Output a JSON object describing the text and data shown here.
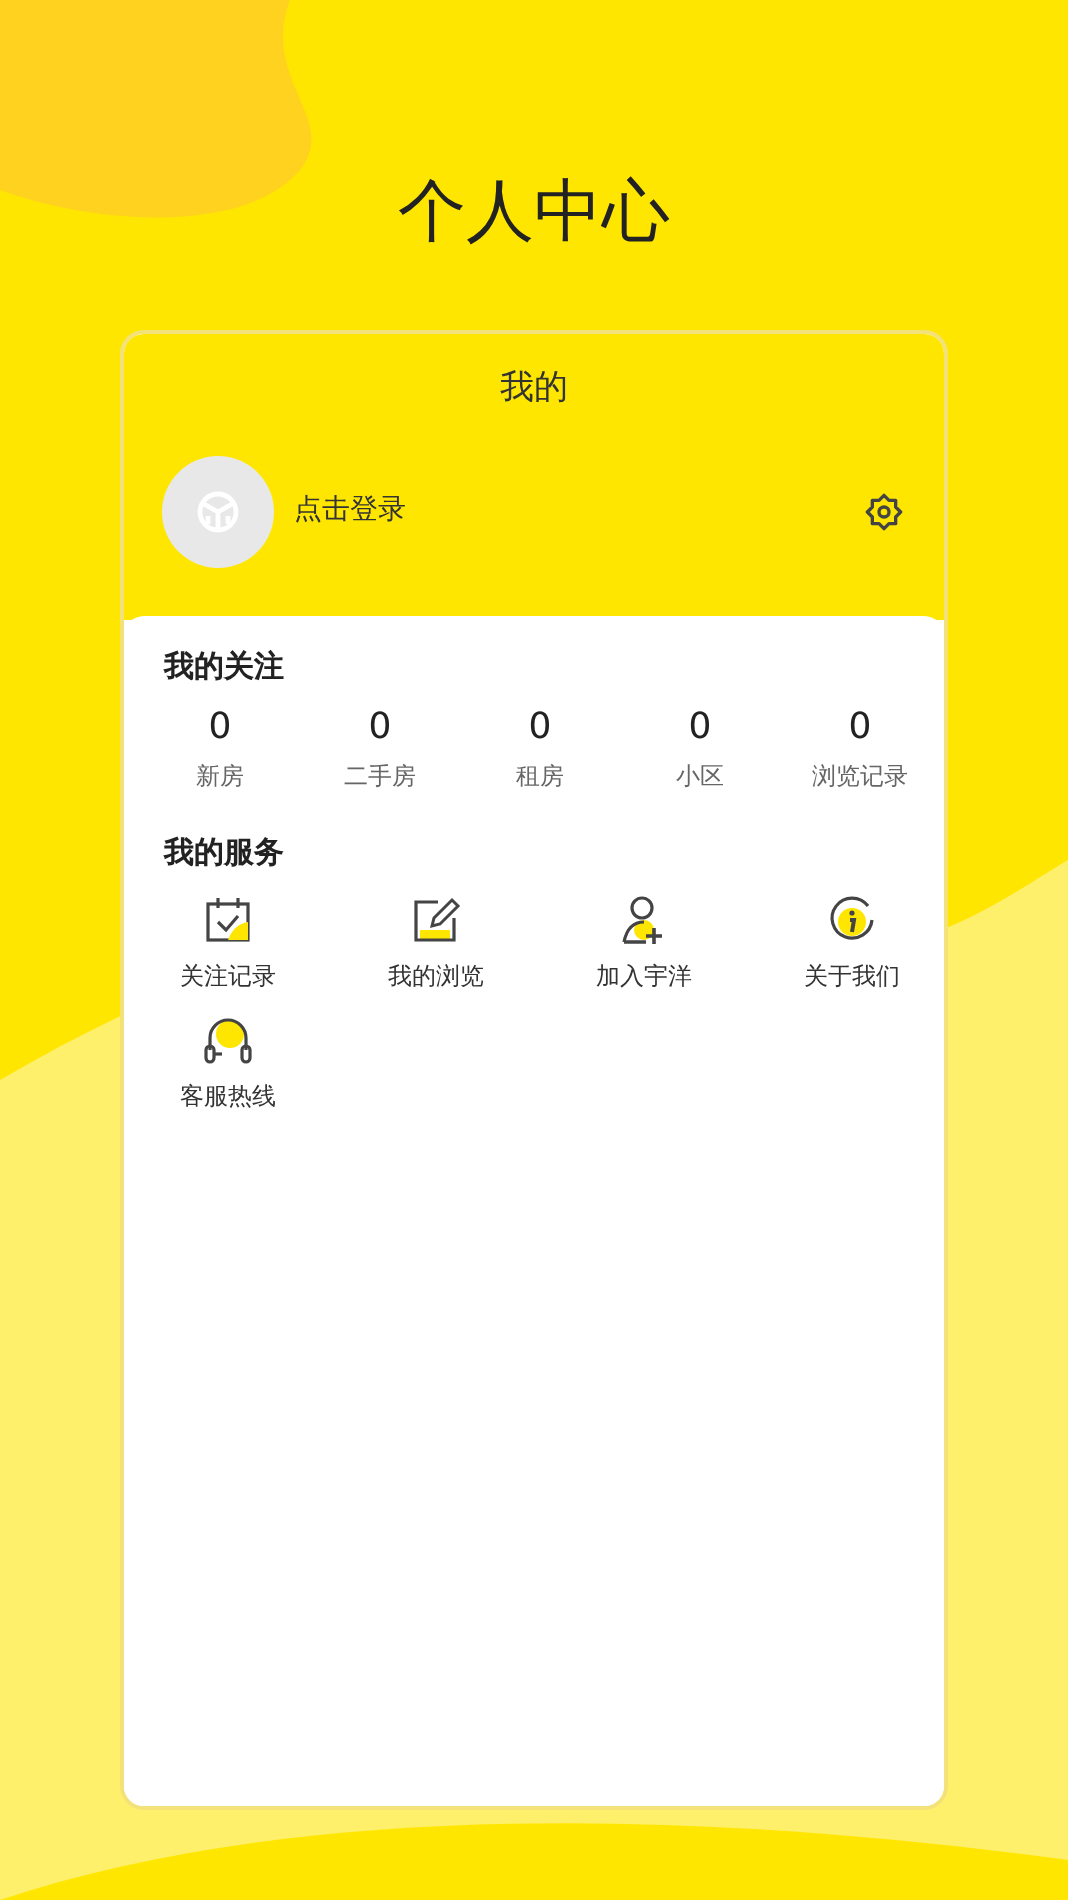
{
  "page_title": "个人中心",
  "card": {
    "title": "我的",
    "login": "点击登录"
  },
  "follows": {
    "heading": "我的关注",
    "items": [
      {
        "count": "0",
        "label": "新房"
      },
      {
        "count": "0",
        "label": "二手房"
      },
      {
        "count": "0",
        "label": "租房"
      },
      {
        "count": "0",
        "label": "小区"
      },
      {
        "count": "0",
        "label": "浏览记录"
      }
    ]
  },
  "services": {
    "heading": "我的服务",
    "items": [
      {
        "kind": "calendar",
        "label": "关注记录"
      },
      {
        "kind": "edit",
        "label": "我的浏览"
      },
      {
        "kind": "user-add",
        "label": "加入宇洋"
      },
      {
        "kind": "info",
        "label": "关于我们"
      },
      {
        "kind": "headset",
        "label": "客服热线"
      }
    ]
  }
}
